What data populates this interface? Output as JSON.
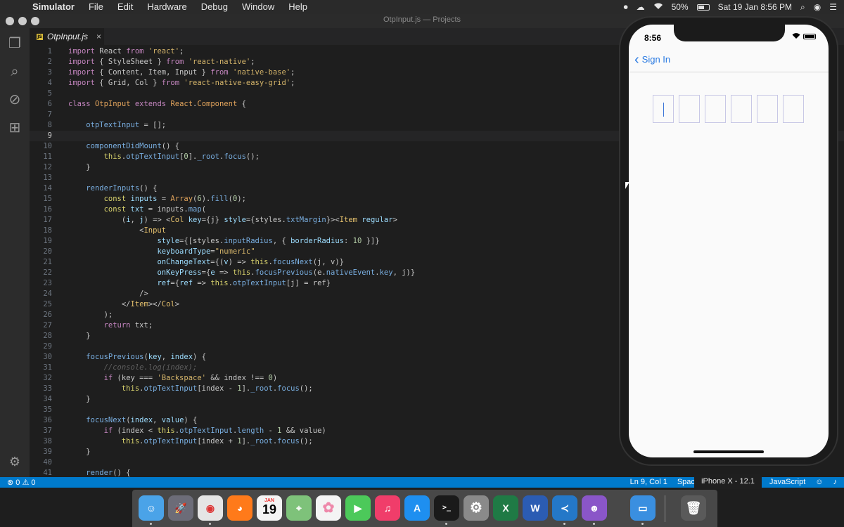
{
  "menubar": {
    "app": "Simulator",
    "items": [
      "File",
      "Edit",
      "Hardware",
      "Debug",
      "Window",
      "Help"
    ],
    "battery": "50%",
    "datetime": "Sat 19 Jan  8:56 PM"
  },
  "window": {
    "title": "OtpInput.js — Projects",
    "tab": {
      "name": "OtpInput.js",
      "badge": "JS",
      "close": "×"
    }
  },
  "editor": {
    "lines": [
      {
        "n": "1",
        "html": "<span class=\"kw\">import</span> React <span class=\"kw\">from</span> <span class=\"str\">'react'</span>;"
      },
      {
        "n": "2",
        "html": "<span class=\"kw\">import</span> { StyleSheet } <span class=\"kw\">from</span> <span class=\"str\">'react-native'</span>;"
      },
      {
        "n": "3",
        "html": "<span class=\"kw\">import</span> { Content, Item, Input } <span class=\"kw\">from</span> <span class=\"str\">'native-base'</span>;"
      },
      {
        "n": "4",
        "html": "<span class=\"kw\">import</span> { Grid, Col } <span class=\"kw\">from</span> <span class=\"str\">'react-native-easy-grid'</span>;"
      },
      {
        "n": "5",
        "html": ""
      },
      {
        "n": "6",
        "html": "<span class=\"kw\">class</span> <span class=\"cls\">OtpInput</span> <span class=\"kw\">extends</span> <span class=\"cls\">React</span>.<span class=\"cls\">Component</span> {"
      },
      {
        "n": "7",
        "html": ""
      },
      {
        "n": "8",
        "html": "    <span class=\"fn\">otpTextInput</span> = [];"
      },
      {
        "n": "9",
        "html": "",
        "current": true
      },
      {
        "n": "10",
        "html": "    <span class=\"fn\">componentDidMount</span>() {"
      },
      {
        "n": "11",
        "html": "        <span class=\"prop\">this</span>.<span class=\"fn\">otpTextInput</span>[<span class=\"num\">0</span>].<span class=\"fn\">_root</span>.<span class=\"fn\">focus</span>();"
      },
      {
        "n": "12",
        "html": "    }"
      },
      {
        "n": "13",
        "html": ""
      },
      {
        "n": "14",
        "html": "    <span class=\"fn\">renderInputs</span>() {"
      },
      {
        "n": "15",
        "html": "        <span class=\"prop\">const</span> <span class=\"attr\">inputs</span> = <span class=\"cls\">Array</span>(<span class=\"num\">6</span>).<span class=\"fn\">fill</span>(<span class=\"num\">0</span>);"
      },
      {
        "n": "16",
        "html": "        <span class=\"prop\">const</span> <span class=\"attr\">txt</span> = inputs.<span class=\"fn\">map</span>("
      },
      {
        "n": "17",
        "html": "            (<span class=\"attr\">i</span>, <span class=\"attr\">j</span>) => &lt;<span class=\"tag\">Col</span> <span class=\"attr\">key</span>={j} <span class=\"attr\">style</span>={styles.<span class=\"fn\">txtMargin</span>}>&lt;<span class=\"tag\">Item</span> <span class=\"attr\">regular</span>>"
      },
      {
        "n": "18",
        "html": "                &lt;<span class=\"tag\">Input</span>"
      },
      {
        "n": "19",
        "html": "                    <span class=\"attr\">style</span>={[styles.<span class=\"fn\">inputRadius</span>, { <span class=\"attr\">borderRadius</span>: <span class=\"num\">10</span> }]}"
      },
      {
        "n": "20",
        "html": "                    <span class=\"attr\">keyboardType</span>=<span class=\"str\">\"numeric\"</span>"
      },
      {
        "n": "21",
        "html": "                    <span class=\"attr\">onChangeText</span>={(<span class=\"attr\">v</span>) => <span class=\"prop\">this</span>.<span class=\"fn\">focusNext</span>(j, v)}"
      },
      {
        "n": "22",
        "html": "                    <span class=\"attr\">onKeyPress</span>={<span class=\"attr\">e</span> => <span class=\"prop\">this</span>.<span class=\"fn\">focusPrevious</span>(e.<span class=\"fn\">nativeEvent</span>.<span class=\"fn\">key</span>, j)}"
      },
      {
        "n": "23",
        "html": "                    <span class=\"attr\">ref</span>={<span class=\"attr\">ref</span> => <span class=\"prop\">this</span>.<span class=\"fn\">otpTextInput</span>[j] = ref}"
      },
      {
        "n": "24",
        "html": "                />"
      },
      {
        "n": "25",
        "html": "            &lt;/<span class=\"tag\">Item</span>>&lt;/<span class=\"tag\">Col</span>>"
      },
      {
        "n": "26",
        "html": "        );"
      },
      {
        "n": "27",
        "html": "        <span class=\"kw\">return</span> txt;"
      },
      {
        "n": "28",
        "html": "    }"
      },
      {
        "n": "29",
        "html": ""
      },
      {
        "n": "30",
        "html": "    <span class=\"fn\">focusPrevious</span>(<span class=\"attr\">key</span>, <span class=\"attr\">index</span>) {"
      },
      {
        "n": "31",
        "html": "        <span class=\"cmt\">//console.log(index);</span>"
      },
      {
        "n": "32",
        "html": "        <span class=\"kw\">if</span> (key === <span class=\"str\">'Backspace'</span> &amp;&amp; index !== <span class=\"num\">0</span>)"
      },
      {
        "n": "33",
        "html": "            <span class=\"prop\">this</span>.<span class=\"fn\">otpTextInput</span>[index - <span class=\"num\">1</span>].<span class=\"fn\">_root</span>.<span class=\"fn\">focus</span>();"
      },
      {
        "n": "34",
        "html": "    }"
      },
      {
        "n": "35",
        "html": ""
      },
      {
        "n": "36",
        "html": "    <span class=\"fn\">focusNext</span>(<span class=\"attr\">index</span>, <span class=\"attr\">value</span>) {"
      },
      {
        "n": "37",
        "html": "        <span class=\"kw\">if</span> (index &lt; <span class=\"prop\">this</span>.<span class=\"fn\">otpTextInput</span>.<span class=\"fn\">length</span> - <span class=\"num\">1</span> &amp;&amp; value)"
      },
      {
        "n": "38",
        "html": "            <span class=\"prop\">this</span>.<span class=\"fn\">otpTextInput</span>[index + <span class=\"num\">1</span>].<span class=\"fn\">_root</span>.<span class=\"fn\">focus</span>();"
      },
      {
        "n": "39",
        "html": "    }"
      },
      {
        "n": "40",
        "html": ""
      },
      {
        "n": "41",
        "html": "    <span class=\"fn\">render</span>() {"
      }
    ]
  },
  "statusbar": {
    "errors": "⊗ 0",
    "warnings": "⚠ 0",
    "position": "Ln 9, Col 1",
    "spaces": "Spac",
    "language": "JavaScript"
  },
  "tooltip": "iPhone X - 12.1",
  "phone": {
    "time": "8:56",
    "back_label": "Sign In",
    "otp_count": 6
  },
  "dock": [
    "Finder",
    "Launchpad",
    "Chrome",
    "Firefox",
    "Calendar",
    "Maps",
    "Photos",
    "FaceTime",
    "Music",
    "App Store",
    "Terminal",
    "System Preferences",
    "Excel",
    "Word",
    "VS Code",
    "GitHub",
    "Simulator",
    "Trash"
  ],
  "calendar": {
    "month": "JAN",
    "day": "19"
  },
  "colors": {
    "accent": "#007acc",
    "ios_blue": "#2a7ae2"
  }
}
